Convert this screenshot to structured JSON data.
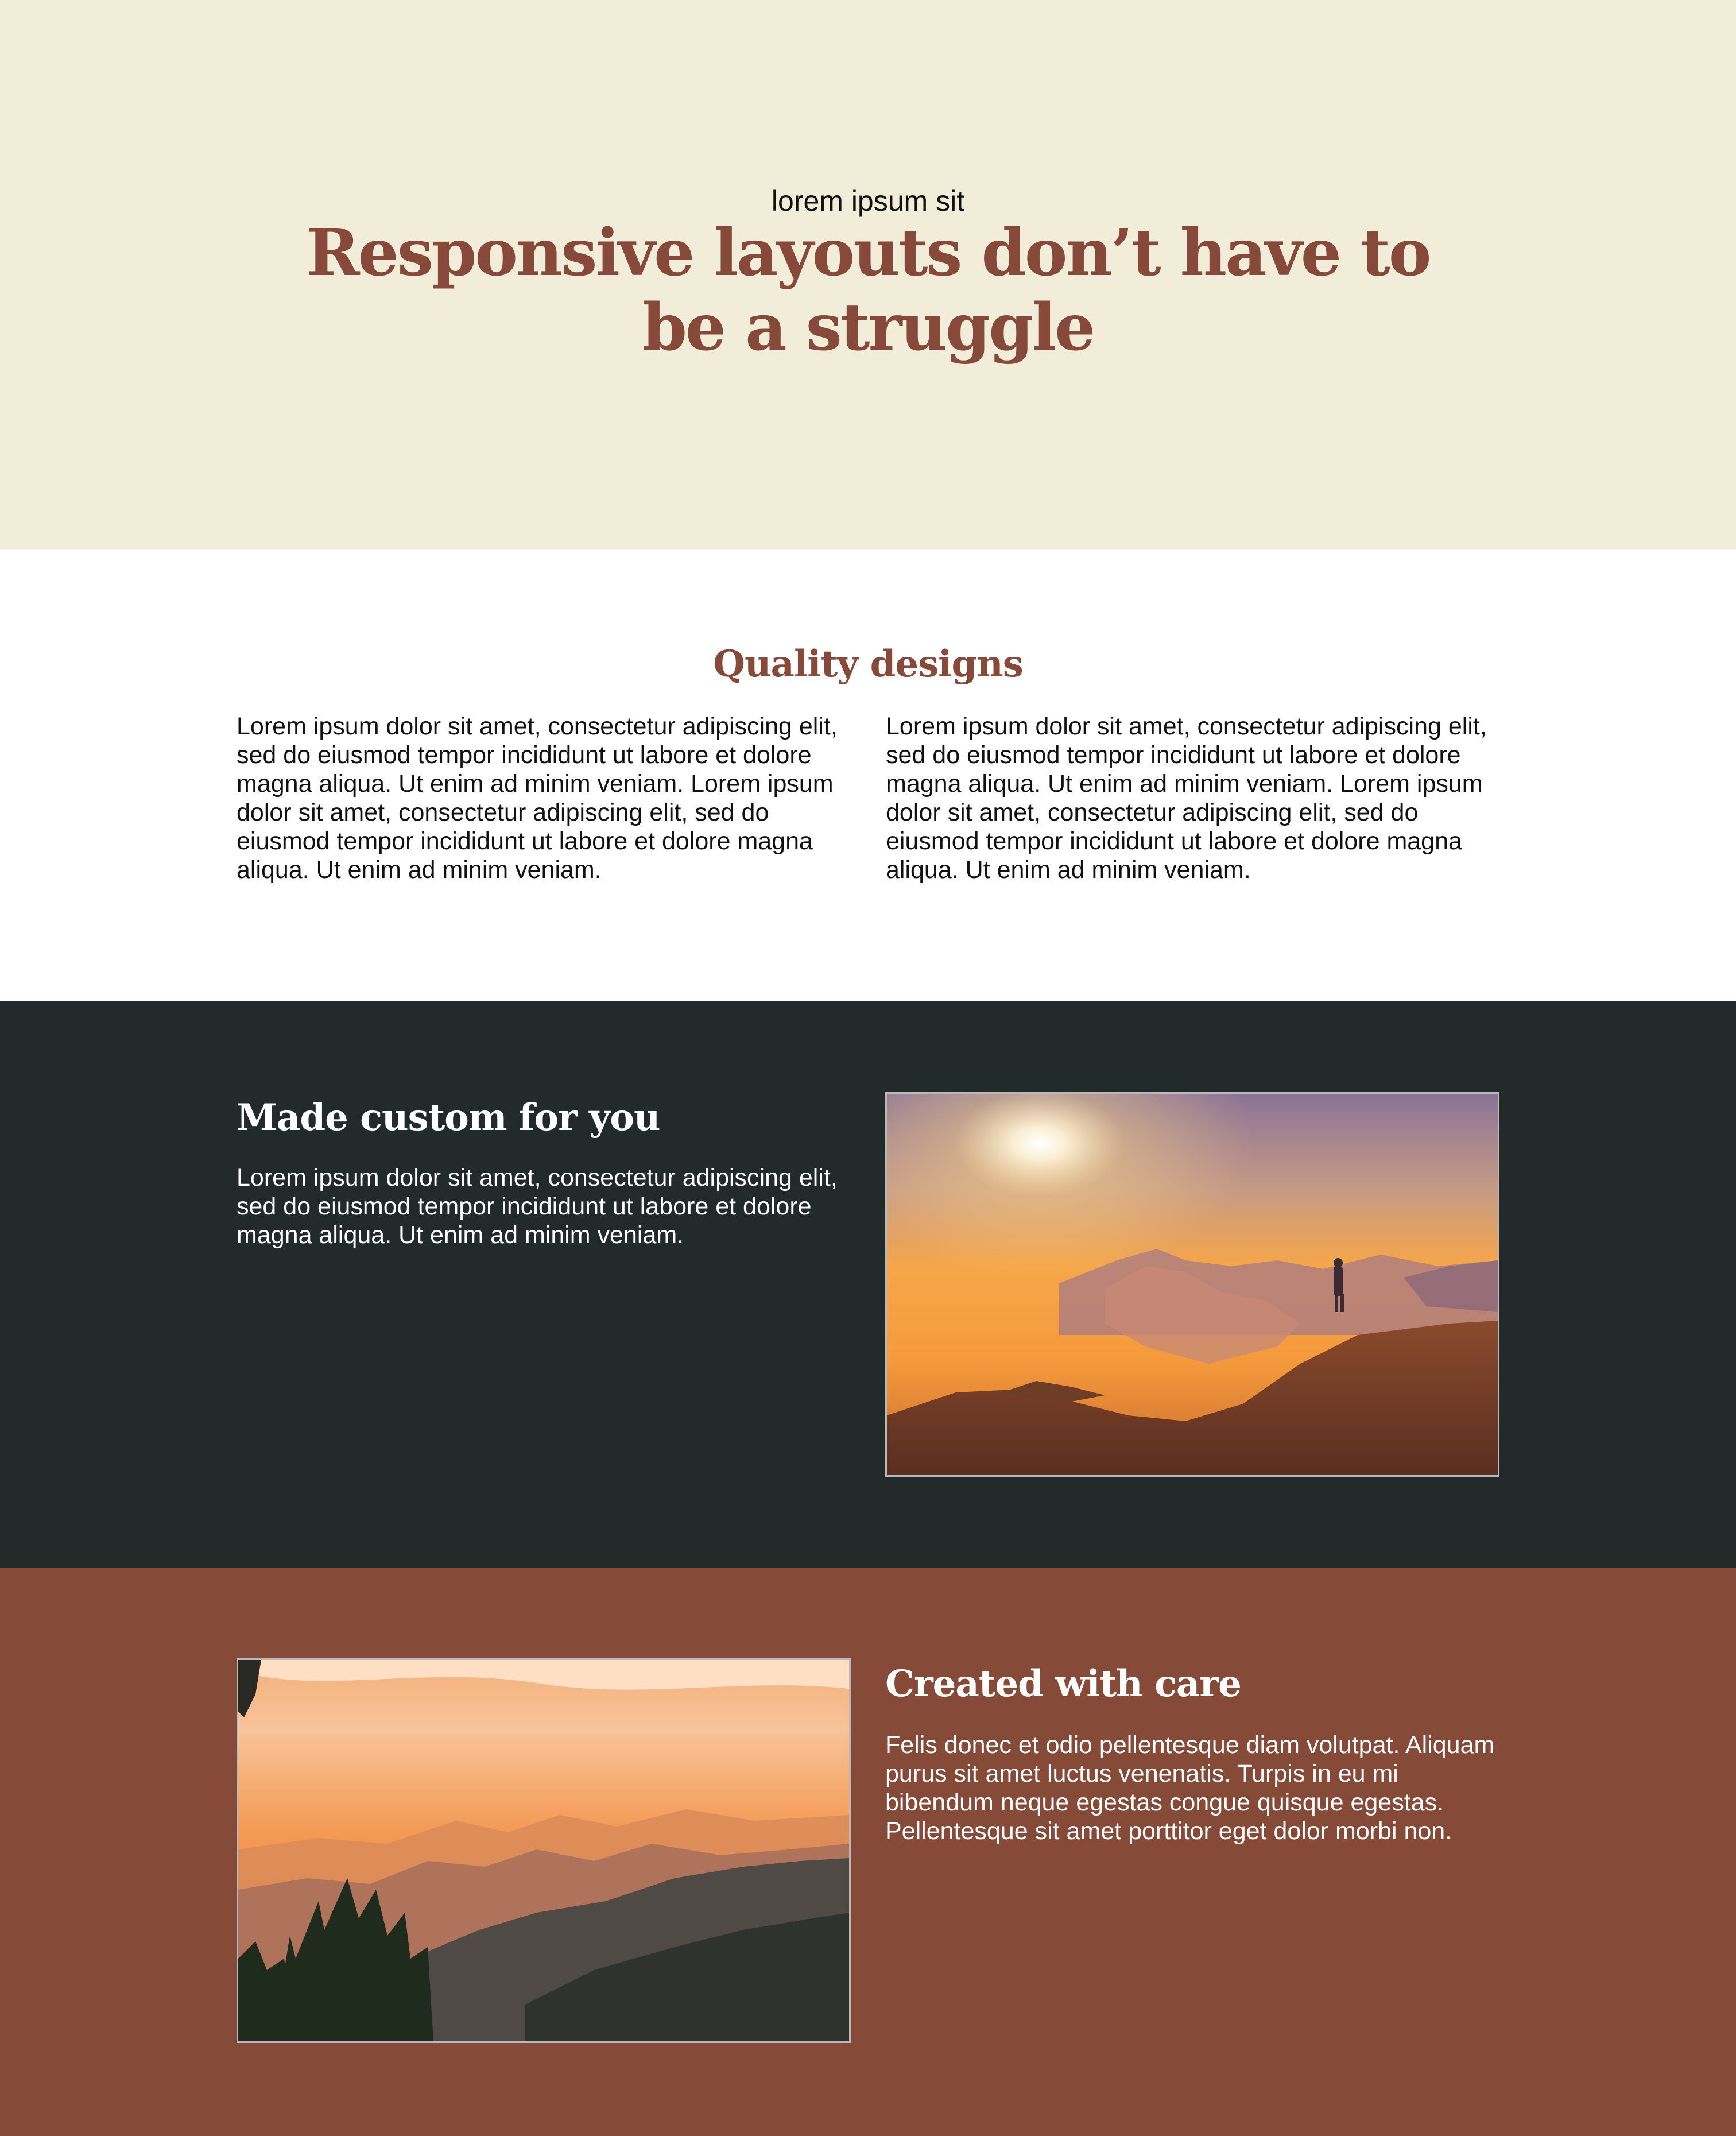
{
  "hero": {
    "kicker": "lorem ipsum sit",
    "title": "Responsive layouts don’t have to be a struggle",
    "background": "#f2edd9",
    "title_color": "#86493a"
  },
  "quality": {
    "title": "Quality designs",
    "columns": [
      "Lorem ipsum dolor sit amet, consectetur adipiscing elit, sed do eiusmod tempor incididunt ut labore et dolore magna aliqua. Ut enim ad minim veniam. Lorem ipsum dolor sit amet, consectetur adipiscing elit, sed do eiusmod tempor incididunt ut labore et dolore magna aliqua. Ut enim ad minim veniam.",
      "Lorem ipsum dolor sit amet, consectetur adipiscing elit, sed do eiusmod tempor incididunt ut labore et dolore magna aliqua. Ut enim ad minim veniam. Lorem ipsum dolor sit amet, consectetur adipiscing elit, sed do eiusmod tempor incididunt ut labore et dolore magna aliqua. Ut enim ad minim veniam."
    ]
  },
  "custom": {
    "title": "Made custom for you",
    "text": "Lorem ipsum dolor sit amet, consectetur adipiscing elit, sed do eiusmod tempor incididunt ut labore et dolore magna aliqua. Ut enim ad minim veniam.",
    "background": "#232a2a",
    "image": "sunrise-mountain-hiker-photo"
  },
  "care": {
    "title": "Created with care",
    "text": "Felis donec et odio pellentesque diam volutpat. Aliquam purus sit amet luctus venenatis. Turpis in eu mi bibendum neque egestas congue quisque egestas. Pellentesque sit amet porttitor eget dolor morbi non.",
    "background": "#864a38",
    "image": "sunset-mountain-ridges-photo"
  }
}
